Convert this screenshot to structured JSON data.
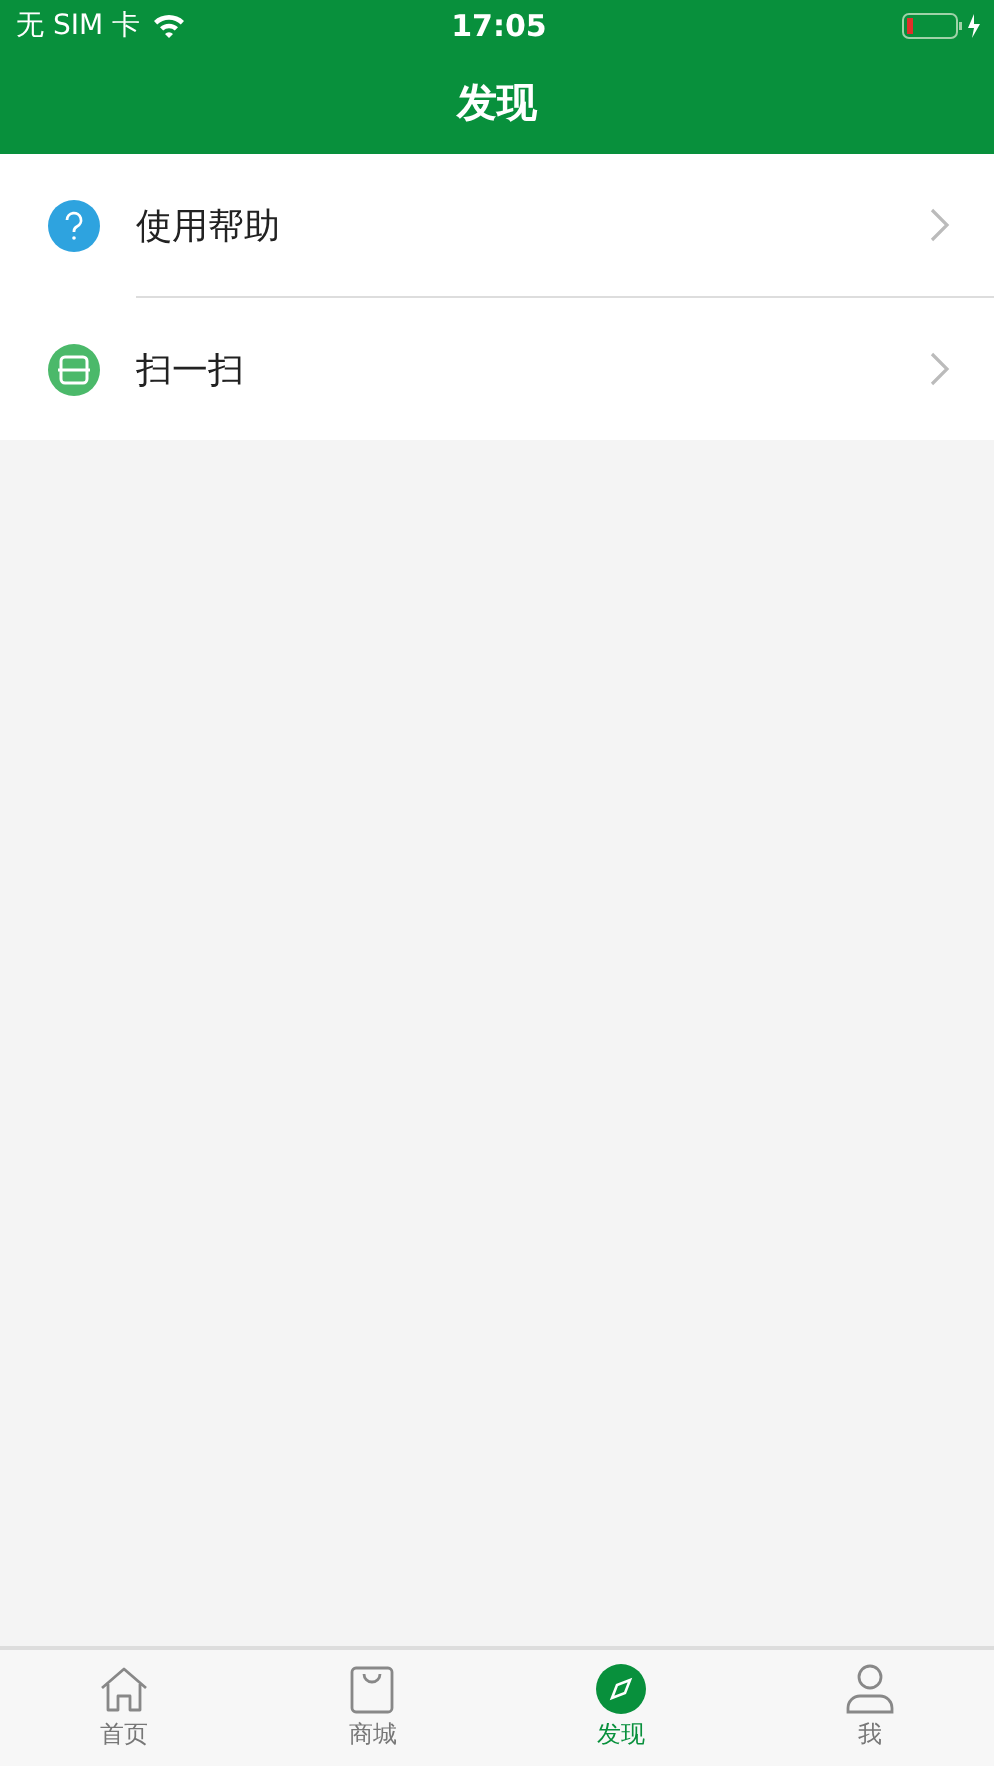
{
  "status_bar": {
    "carrier": "无 SIM 卡",
    "time": "17:05"
  },
  "header": {
    "title": "发现"
  },
  "menu": [
    {
      "kind": "help",
      "label": "使用帮助"
    },
    {
      "kind": "scan",
      "label": "扫一扫"
    }
  ],
  "tab_bar": [
    {
      "kind": "home",
      "label": "首页",
      "selected": false
    },
    {
      "kind": "shop",
      "label": "商城",
      "selected": false
    },
    {
      "kind": "discover",
      "label": "发现",
      "selected": true
    },
    {
      "kind": "me",
      "label": "我",
      "selected": false
    }
  ]
}
